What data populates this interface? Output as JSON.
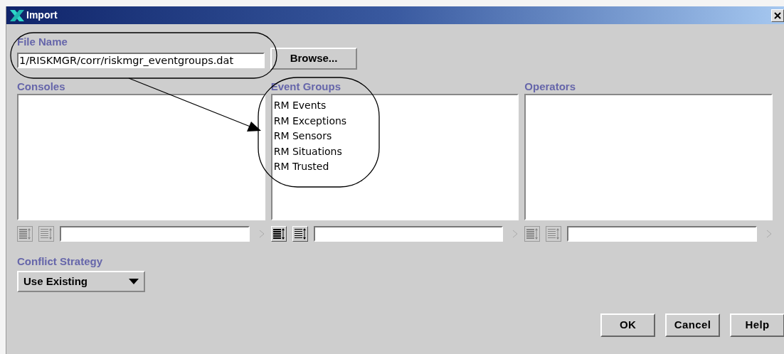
{
  "window": {
    "title": "Import"
  },
  "file_name": {
    "label": "File Name",
    "value": "1/RISKMGR/corr/riskmgr_eventgroups.dat",
    "browse": "Browse..."
  },
  "panels": [
    {
      "title": "Consoles",
      "enabled": false
    },
    {
      "title": "Event Groups",
      "enabled": true,
      "items": [
        "RM Events",
        "RM Exceptions",
        "RM Sensors",
        "RM Situations",
        "RM Trusted"
      ]
    },
    {
      "title": "Operators",
      "enabled": false
    }
  ],
  "conflict_strategy": {
    "label": "Conflict Strategy",
    "value": "Use Existing"
  },
  "buttons": [
    "OK",
    "Cancel",
    "Help"
  ]
}
